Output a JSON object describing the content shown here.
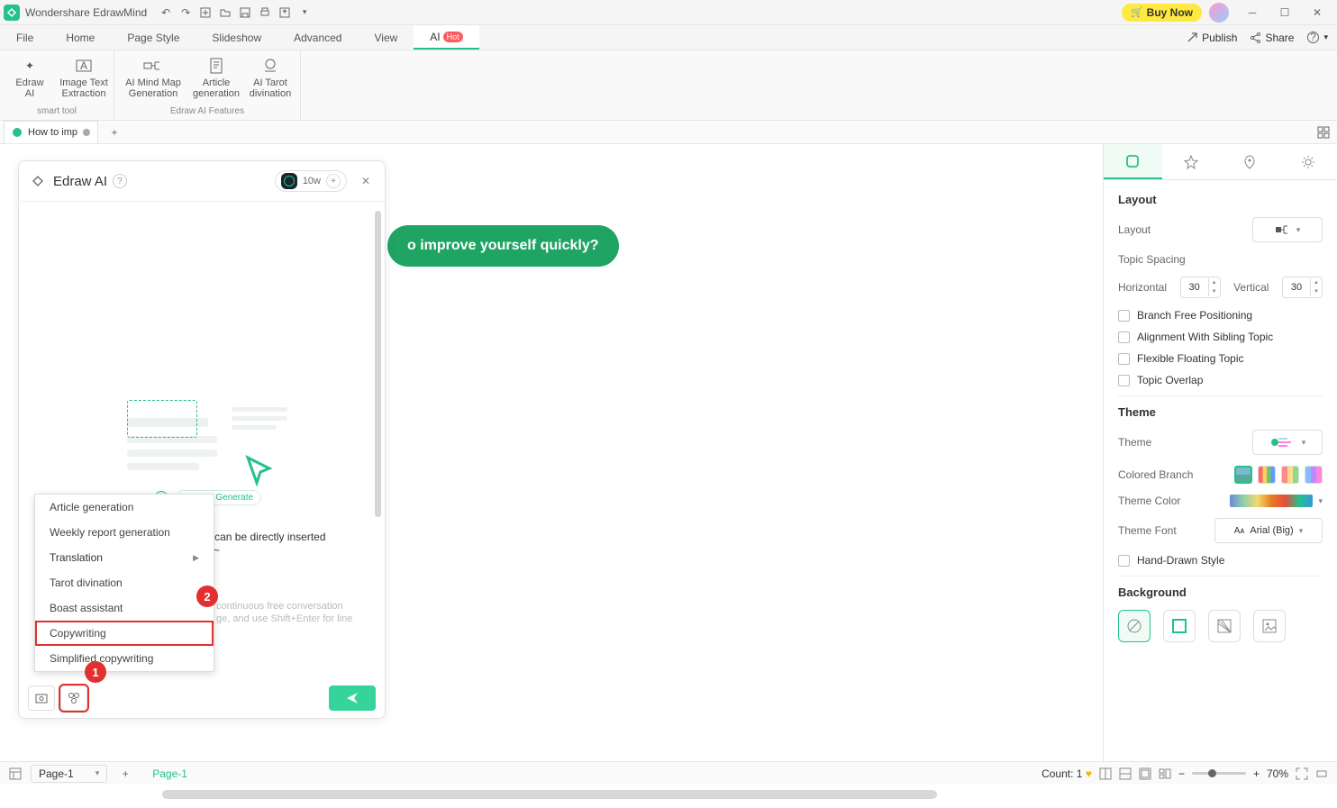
{
  "app": {
    "title": "Wondershare EdrawMind",
    "buy": "Buy Now",
    "publish": "Publish",
    "share": "Share"
  },
  "menu": {
    "file": "File",
    "home": "Home",
    "page_style": "Page Style",
    "slideshow": "Slideshow",
    "advanced": "Advanced",
    "view": "View",
    "ai": "AI",
    "hot": "Hot"
  },
  "ribbon": {
    "group1": "smart tool",
    "group2": "Edraw AI Features",
    "edraw_ai": "Edraw\nAI",
    "image_text": "Image Text\nExtraction",
    "mindmap": "AI Mind Map\nGeneration",
    "article": "Article\ngeneration",
    "tarot": "AI Tarot\ndivination"
  },
  "doc_tab": "How to imp",
  "canvas_bubble": "o improve yourself quickly?",
  "ai_panel": {
    "title": "Edraw AI",
    "credits": "10w",
    "stop": "Stop Generate",
    "tip": "Tip: AI-generated content can be directly inserted",
    "tip2": "vas~",
    "hint": "continuous free conversation\nge, and use Shift+Enter for line"
  },
  "context_menu": {
    "items": [
      "Article generation",
      "Weekly report generation",
      "Translation",
      "Tarot divination",
      "Boast assistant",
      "Copywriting",
      "Simplified copywriting"
    ]
  },
  "badges": {
    "b1": "1",
    "b2": "2"
  },
  "right": {
    "layout_h": "Layout",
    "layout": "Layout",
    "topic_spacing": "Topic Spacing",
    "horizontal": "Horizontal",
    "hv": "30",
    "vertical": "Vertical",
    "vv": "30",
    "branch_free": "Branch Free Positioning",
    "align_sibling": "Alignment With Sibling Topic",
    "flexible": "Flexible Floating Topic",
    "overlap": "Topic Overlap",
    "theme_h": "Theme",
    "theme": "Theme",
    "colored_branch": "Colored Branch",
    "theme_color": "Theme Color",
    "theme_font": "Theme Font",
    "font_val": "Arial (Big)",
    "hand_drawn": "Hand-Drawn Style",
    "background_h": "Background"
  },
  "status": {
    "page_sel": "Page-1",
    "page_tab": "Page-1",
    "count": "Count: 1",
    "zoom": "70%"
  }
}
